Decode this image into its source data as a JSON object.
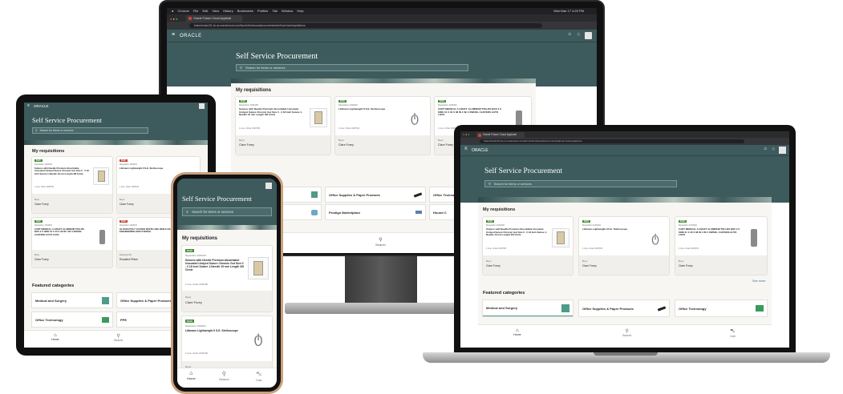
{
  "colors": {
    "oracle_teal": "#3d5a5c",
    "badge_green": "#4a8f3b",
    "red_accent": "#c74634"
  },
  "browser": {
    "menubar": [
      "Chrome",
      "File",
      "Edit",
      "View",
      "History",
      "Bookmarks",
      "Profiles",
      "Tab",
      "Window",
      "Help"
    ],
    "tab_title": "Oracle Fusion Cloud Applicati",
    "url": "fusionhosts101-fa.us.oraclecloud.com/fscmUI/redwood/procurement/self-service/requisitions",
    "clock": "Wed Mar 17 4:20 PM"
  },
  "app": {
    "brand": "ORACLE",
    "title": "Self Service Procurement",
    "search_placeholder": "Search for items or services",
    "section_title": "My requisitions",
    "see_more": "See more",
    "featured_title": "Featured categories",
    "nav": {
      "home": "Home",
      "search": "Search",
      "cart": "Cart"
    }
  },
  "requisitions": [
    {
      "status": "Draft",
      "number": "Requisition 1033148",
      "title": "Sutures with Needle Premium Absorbable Uncoated Undyed Suture Chromic Gut Size 0 - 0 18 Inch Suture 1-Needle 19 mm Length 3/8 Circle",
      "lines": "1 Line, Order 1033796",
      "buyer_label": "Buyer",
      "buyer": "Clare Furey"
    },
    {
      "status": "Draft",
      "number": "Requisition 1033403",
      "title": "Littmann Lightweight II S.E. Stethoscope",
      "lines": "1 Line, Order 1033702",
      "buyer_label": "Buyer",
      "buyer": "Clare Furey"
    },
    {
      "status": "Draft",
      "number": "Requisition 1033402",
      "title": "CART MEDICAL A GRAFT ALUMINUM TRLLRS BOX 2 X SIDE 31 X 40 X 38 IN 1 W/ 4 SWIVEL CASTERS AUTO LOCK",
      "lines": "1 Line, Order 1033701",
      "buyer_label": "Buyer",
      "buyer": "Clare Furey"
    },
    {
      "status": "Draft",
      "number": "Requisition 1033401",
      "title": "GLOVES POLY COATED WHITE LINE WHILE EXAMINATION LATEX ENGINEERING NON STERILE",
      "lines": "1 Line, Order 1033700",
      "buyer_label": "Requested By",
      "buyer": "Rosalind Rhine"
    }
  ],
  "categories": [
    {
      "name": "Medical and Surgery",
      "icon": "medical-icon"
    },
    {
      "name": "Office Supplies & Paper Products",
      "icon": "pen-icon"
    },
    {
      "name": "Office Technology",
      "icon": "tech-icon"
    },
    {
      "name": "PPE",
      "icon": "ppe-icon"
    },
    {
      "name": "Prodigo Marketplace",
      "icon": "marketplace-icon"
    },
    {
      "name": "Hound C",
      "icon": "hound-icon"
    }
  ]
}
